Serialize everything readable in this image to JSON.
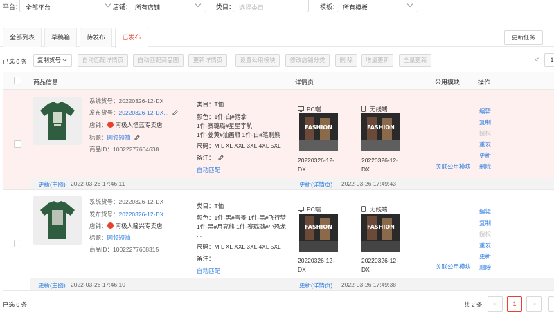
{
  "filters": {
    "platform_label": "平台：",
    "platform_value": "全部平台",
    "shop_label": "店铺：",
    "shop_value": "所有店铺",
    "category_label": "类目：",
    "category_value": "选择类目",
    "template_label": "模板：",
    "template_value": "所有模板"
  },
  "tabs": [
    {
      "label": "全部列表"
    },
    {
      "label": "草稿箱"
    },
    {
      "label": "待发布"
    },
    {
      "label": "已发布"
    }
  ],
  "refresh_task_label": "更新任务",
  "toolbar": {
    "selected": "已选 0 条",
    "copy_sku": "复制货号",
    "buttons": [
      "自动匹配详情页",
      "自动匹配商品图",
      "更新详情页",
      "设置公用模块",
      "修改店铺分类",
      "删 除",
      "增量更新",
      "全量更新"
    ],
    "page_prev": "<",
    "page_num": "1"
  },
  "table": {
    "headers": {
      "product_info": "商品信息",
      "detail_page": "详情页",
      "public_module": "公用模块",
      "actions": "操作"
    }
  },
  "rows": [
    {
      "system_sku": "系统货号：20220326-12-DX",
      "publish_sku_label": "发布货号：",
      "publish_sku": "20220326-12-DX...",
      "shop_label": "店铺：",
      "shop": "南极人恒蓝专卖店",
      "title_label": "标题：",
      "title": "圆领短袖",
      "product_id": "商品ID：10022277604638",
      "category": "类目：T恤",
      "colors": [
        "颜色：1件-白#猪拳",
        "1件-赛璐璐#星星宇航",
        "1件-姜黄#油画瓶 1件-白#笔刷熊"
      ],
      "sizes": "尺码：M L XL XXL 3XL 4XL 5XL",
      "note": "备注：",
      "auto_match": "自动匹配",
      "pc_label": "PC端",
      "mobile_label": "无线端",
      "pc_date": "20220326-12-DX",
      "mobile_date": "20220326-12-DX",
      "public_module_link": "关联公用模块",
      "ops": [
        "编辑",
        "复制",
        "授权",
        "重发",
        "更新",
        "删除"
      ],
      "foot_update_main": "更新(主图)",
      "foot_time_main": "2022-03-26 17:46:11",
      "foot_update_detail": "更新(详情页)",
      "foot_time_detail": "2022-03-26 17:49:43",
      "image_text": "FASHION"
    },
    {
      "system_sku": "系统货号：20220326-12-DX",
      "publish_sku_label": "发布货号：",
      "publish_sku": "20220326-12-DX...",
      "shop_label": "店铺：",
      "shop": "南极人瞳兴专卖店",
      "title_label": "标题：",
      "title": "圆领短袖",
      "product_id": "商品ID：10022277608315",
      "category": "类目：T恤",
      "colors": [
        "颜色：1件-黑#雪景 1件-黑#飞行梦",
        "1件-黑#月亮熊 1件-赛璐璐#小恐龙",
        "..."
      ],
      "sizes": "尺码：M L XL XXL 3XL 4XL 5XL",
      "note": "备注：",
      "auto_match": "自动匹配",
      "pc_label": "PC端",
      "mobile_label": "无线端",
      "pc_date": "20220326-12-DX",
      "mobile_date": "20220326-12-DX",
      "public_module_link": "关联公用模块",
      "ops": [
        "编辑",
        "复制",
        "授权",
        "重发",
        "更新",
        "删除"
      ],
      "foot_update_main": "更新(主图)",
      "foot_time_main": "2022-03-26 17:46:10",
      "foot_update_detail": "更新(详情页)",
      "foot_time_detail": "2022-03-26 17:49:38",
      "image_text": "FASHION"
    }
  ],
  "footer": {
    "selected": "已选 0 条",
    "total": "共 2 条",
    "prev": "<",
    "page": "1",
    "next": ">"
  },
  "colors": {
    "accent": "#e8412d",
    "link": "#2f7de1",
    "row_highlight": "#fef0ef",
    "shirt": "#2f5d3f"
  }
}
